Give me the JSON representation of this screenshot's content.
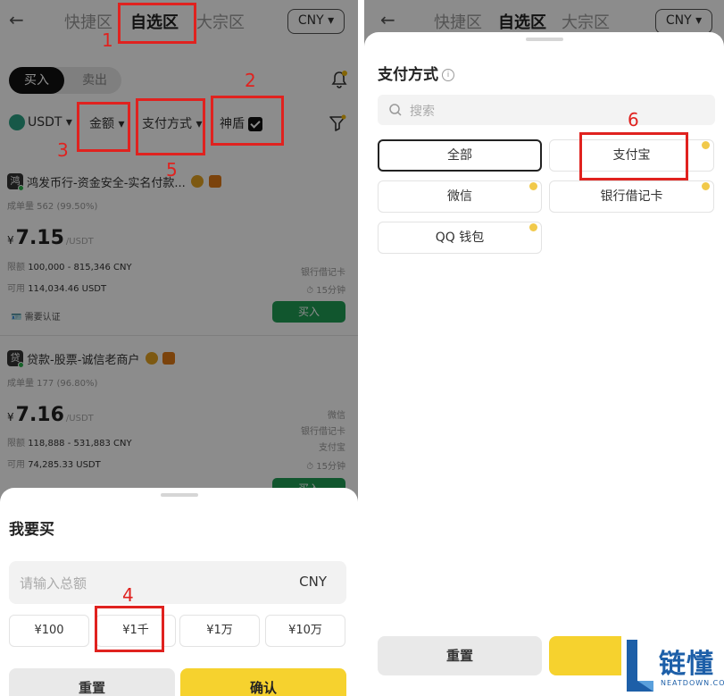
{
  "left": {
    "header": {
      "tabs": [
        "快捷区",
        "自选区",
        "大宗区"
      ],
      "currency": "CNY ▾"
    },
    "trade_tabs": {
      "buy": "买入",
      "sell": "卖出"
    },
    "filters": {
      "coin": "USDT",
      "amount": "金额",
      "payment": "支付方式",
      "shield": "神盾"
    },
    "merchants": [
      {
        "avatar": "鸿",
        "name": "鸿发币行-资金安全-实名付款...",
        "stat": "成单量 562 (99.50%)",
        "price": "7.15",
        "currency_symbol": "¥",
        "price_unit": "/USDT",
        "limit_label": "限额",
        "limit": "100,000 - 815,346 CNY",
        "available_label": "可用",
        "available": "114,034.46 USDT",
        "payments": [
          "银行借记卡"
        ],
        "time": "15分钟",
        "verify": "需要认证",
        "action": "买入"
      },
      {
        "avatar": "贷",
        "name": "贷款-股票-诚信老商户",
        "stat": "成单量 177 (96.80%)",
        "price": "7.16",
        "currency_symbol": "¥",
        "price_unit": "/USDT",
        "limit_label": "限额",
        "limit": "118,888 - 531,883 CNY",
        "available_label": "可用",
        "available": "74,285.33 USDT",
        "payments": [
          "微信",
          "银行借记卡",
          "支付宝"
        ],
        "time": "15分钟",
        "action": "买入"
      }
    ],
    "sheet": {
      "title": "我要买",
      "input_placeholder": "请输入总额",
      "input_currency": "CNY",
      "quick_amounts": [
        "¥100",
        "¥1千",
        "¥1万",
        "¥10万"
      ],
      "reset": "重置",
      "confirm": "确认"
    }
  },
  "right": {
    "header": {
      "tabs": [
        "快捷区",
        "自选区",
        "大宗区"
      ],
      "currency": "CNY ▾"
    },
    "sheet": {
      "title": "支付方式",
      "search_placeholder": "搜索",
      "options": [
        "全部",
        "支付宝",
        "微信",
        "银行借记卡",
        "QQ 钱包"
      ],
      "reset": "重置"
    }
  },
  "annotations": [
    "1",
    "2",
    "3",
    "4",
    "5",
    "6"
  ],
  "watermark": {
    "brand": "链懂",
    "domain": "NEATDOWN.COM"
  },
  "colors": {
    "accent_yellow": "#f6d22e",
    "buy_green": "#1f9d55",
    "annotation_red": "#e0221f"
  }
}
